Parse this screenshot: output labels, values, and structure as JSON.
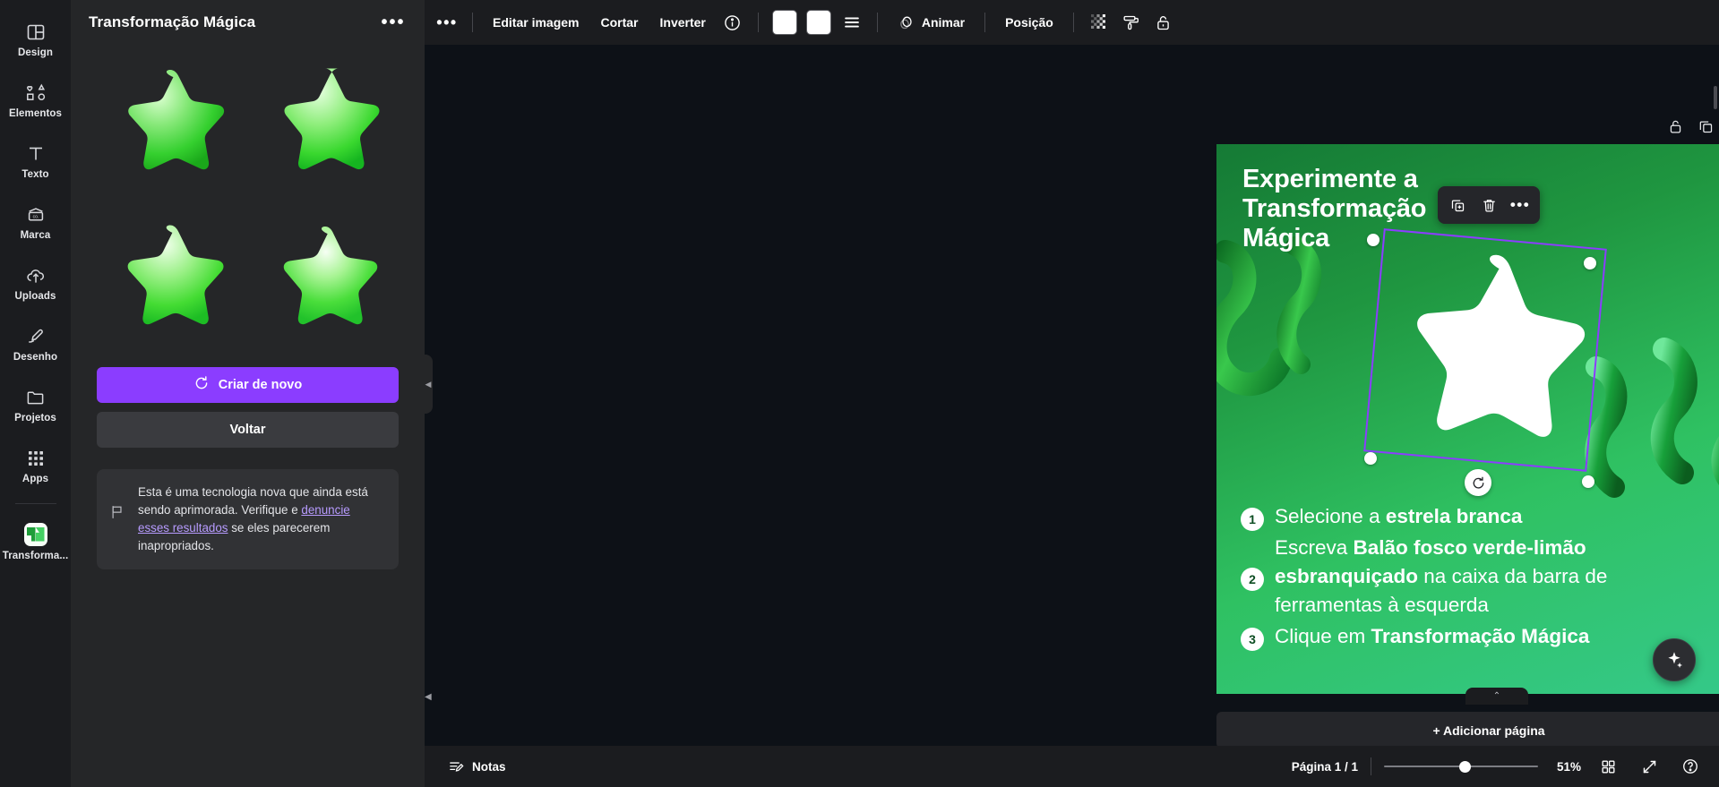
{
  "rail": {
    "items": [
      {
        "label": "Design",
        "icon": "design-icon"
      },
      {
        "label": "Elementos",
        "icon": "elements-icon"
      },
      {
        "label": "Texto",
        "icon": "text-icon"
      },
      {
        "label": "Marca",
        "icon": "brand-icon"
      },
      {
        "label": "Uploads",
        "icon": "uploads-icon"
      },
      {
        "label": "Desenho",
        "icon": "draw-icon"
      },
      {
        "label": "Projetos",
        "icon": "projects-icon"
      },
      {
        "label": "Apps",
        "icon": "apps-icon"
      }
    ],
    "active": {
      "label": "Transforma...",
      "icon": "magic-transform-icon"
    }
  },
  "panel": {
    "title": "Transformação Mágica",
    "more_label": "•••",
    "results_count": 4,
    "result_alt": "estrela verde 3D",
    "primary_button": "Criar de novo",
    "secondary_button": "Voltar",
    "note": {
      "line1": "Esta é uma tecnologia nova que",
      "line2": "ainda está sendo aprimorada.",
      "line3_pre": "Verifique e ",
      "link": "denuncie esses resultados",
      "line3_post": " se eles parecerem",
      "line4": "inapropriados.",
      "icon": "flag-icon"
    }
  },
  "toolbar": {
    "overflow": "•••",
    "edit_image": "Editar imagem",
    "crop": "Cortar",
    "flip": "Inverter",
    "info_icon": "info-icon",
    "swatch1_color": "#ffffff",
    "swatch2_color": "#ffffff",
    "lines_icon": "horizontal-lines-icon",
    "animate": "Animar",
    "animate_icon": "animate-icon",
    "position": "Posição",
    "transparency_icon": "transparency-icon",
    "paint_roller_icon": "paint-roller-icon",
    "lock_icon": "unlock-icon"
  },
  "object_toolbar": {
    "lock_icon": "lock-icon",
    "duplicate_icon": "duplicate-icon",
    "share_icon": "share-icon"
  },
  "mini_toolbar": {
    "duplicate_icon": "duplicate-page-icon",
    "delete_icon": "trash-icon",
    "more_icon": "more-options-icon",
    "more_label": "•••"
  },
  "design": {
    "title": "Experimente a Transformação Mágica",
    "bg_gradient_from": "#157a35",
    "bg_gradient_to": "#35c98a",
    "selected_shape": "white-star",
    "selection_color": "#8b3dff",
    "rotate_icon": "rotate-handle-icon",
    "steps": [
      {
        "num": "1",
        "parts": [
          {
            "text": "Selecione a ",
            "bold": false
          },
          {
            "text": "estrela branca",
            "bold": true
          }
        ]
      },
      {
        "num": "2",
        "parts": [
          {
            "text": "Escreva ",
            "bold": false
          },
          {
            "text": "Balão fosco verde-limão esbranquiçado",
            "bold": true
          },
          {
            "text": " na caixa da barra de ferramentas à esquerda",
            "bold": false
          }
        ]
      },
      {
        "num": "3",
        "parts": [
          {
            "text": "Clique em ",
            "bold": false
          },
          {
            "text": "Transformação Mágica",
            "bold": true
          }
        ]
      }
    ]
  },
  "canvas": {
    "add_page": "+ Adicionar página",
    "assistant_icon": "assistant-sparkle-icon",
    "float_round_icon": "magic-wand-icon",
    "collapse_icon": "chevron-up-icon"
  },
  "statusbar": {
    "notes": "Notas",
    "notes_icon": "notes-icon",
    "page_indicator": "Página 1 / 1",
    "zoom_value": "51%",
    "zoom_percent": 51,
    "grid_icon": "grid-view-icon",
    "fullscreen_icon": "fullscreen-icon",
    "help_icon": "help-icon"
  }
}
